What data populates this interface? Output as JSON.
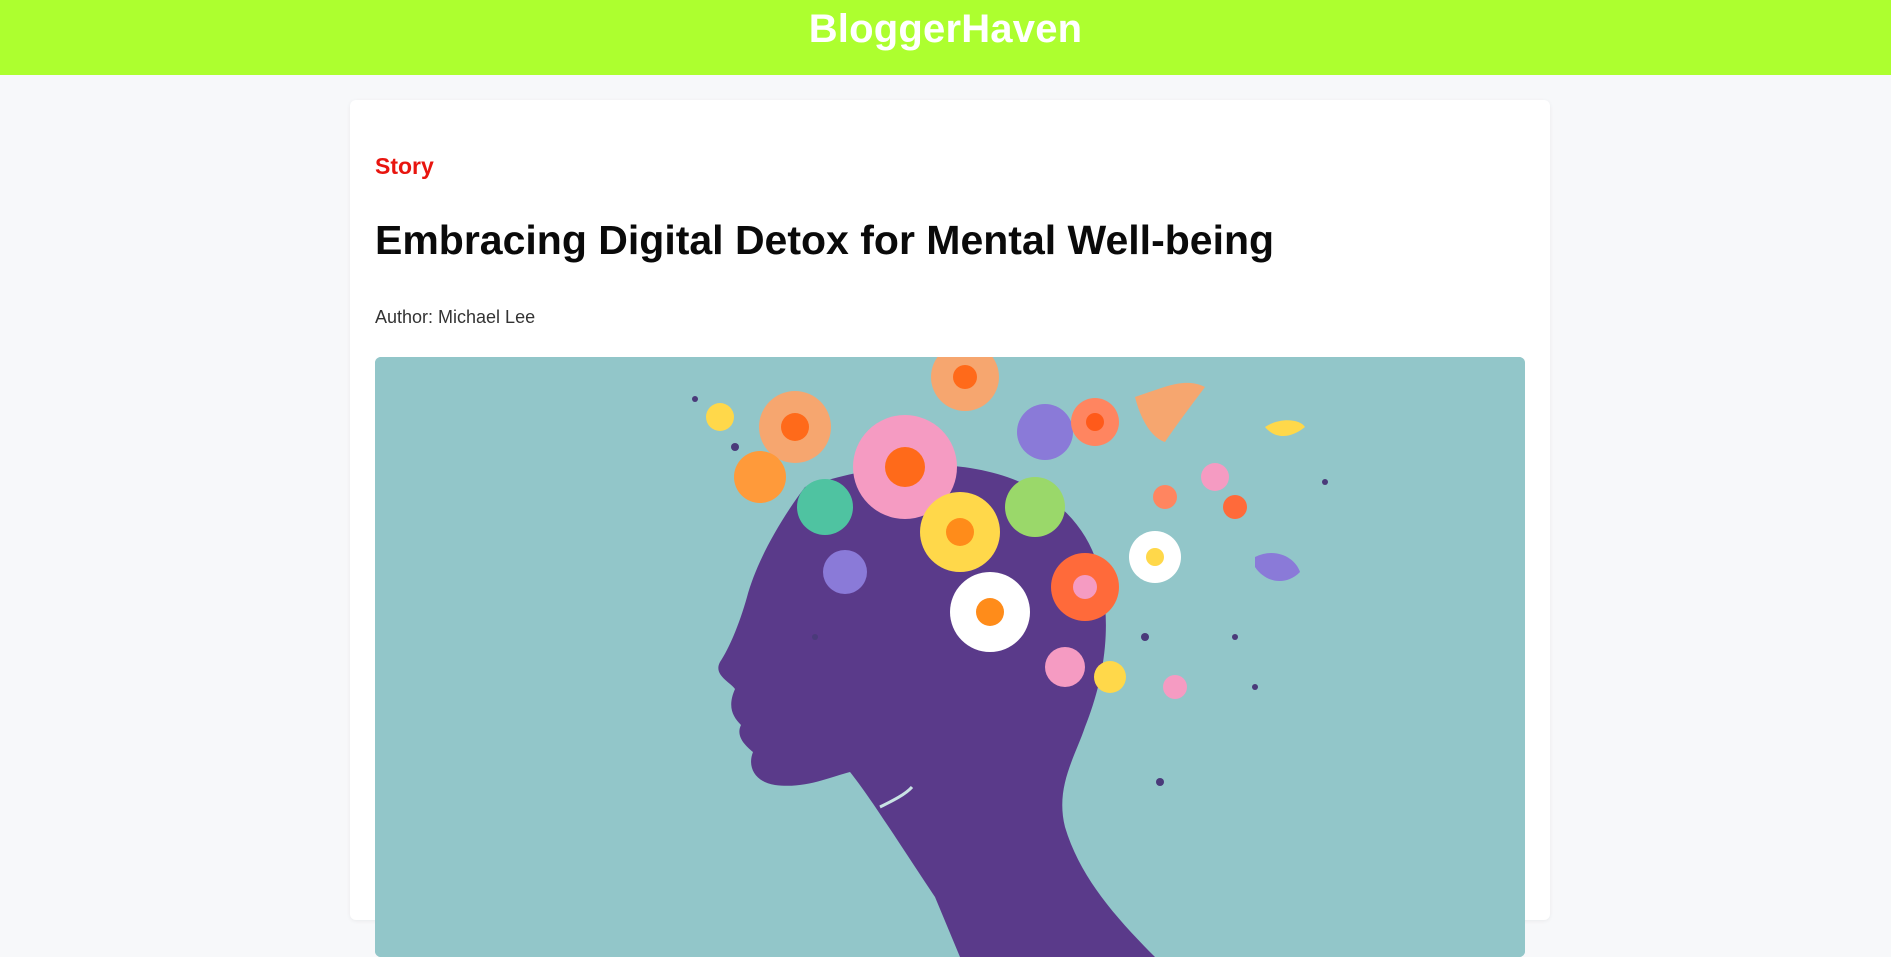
{
  "header": {
    "site_title": "BloggerHaven",
    "background_color": "#adff2f"
  },
  "article": {
    "category": "Story",
    "title": "Embracing Digital Detox for Mental Well-being",
    "author": "Author: Michael Lee",
    "category_color": "#e8150f",
    "hero_image": {
      "subject": "illustration of a purple head silhouette in profile with colorful flowers, butterflies and birds blooming from the head",
      "background_color": "#92c6c9"
    }
  }
}
